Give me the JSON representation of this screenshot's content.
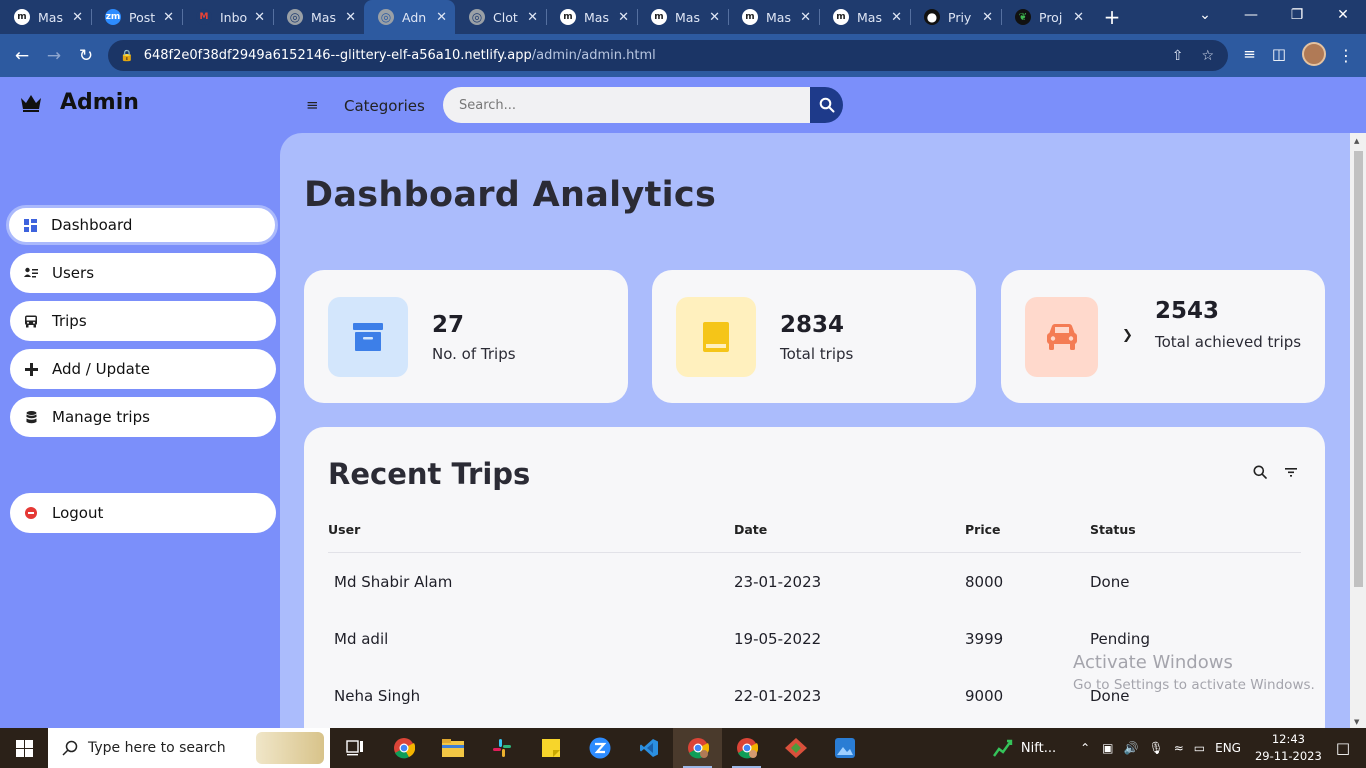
{
  "browser": {
    "tabs": [
      {
        "label": "Mas",
        "icon": "m",
        "icon_bg": "#ffffff",
        "icon_fg": "#222222"
      },
      {
        "label": "Post",
        "icon": "zm",
        "icon_bg": "#2d8cff",
        "icon_fg": "#ffffff"
      },
      {
        "label": "Inbo",
        "icon": "M",
        "icon_bg": "#1f3b6e",
        "icon_fg": "#ea4335"
      },
      {
        "label": "Mas",
        "icon": "globe",
        "icon_bg": "#9aa0a6",
        "icon_fg": "#1f3b6e"
      },
      {
        "label": "Adn",
        "icon": "globe",
        "icon_bg": "#9aa0a6",
        "icon_fg": "#2d5aa0"
      },
      {
        "label": "Clot",
        "icon": "globe",
        "icon_bg": "#9aa0a6",
        "icon_fg": "#1f3b6e"
      },
      {
        "label": "Mas",
        "icon": "m",
        "icon_bg": "#ffffff",
        "icon_fg": "#222222"
      },
      {
        "label": "Mas",
        "icon": "m",
        "icon_bg": "#ffffff",
        "icon_fg": "#222222"
      },
      {
        "label": "Mas",
        "icon": "m",
        "icon_bg": "#ffffff",
        "icon_fg": "#222222"
      },
      {
        "label": "Mas",
        "icon": "m",
        "icon_bg": "#ffffff",
        "icon_fg": "#222222"
      },
      {
        "label": "Priy",
        "icon": "gh",
        "icon_bg": "#111111",
        "icon_fg": "#ffffff"
      },
      {
        "label": "Proj",
        "icon": "leaf",
        "icon_bg": "#111111",
        "icon_fg": "#3fb950"
      }
    ],
    "active_tab_index": 4,
    "url_host": "648f2e0f38df2949a6152146--glittery-elf-a56a10.netlify.app",
    "url_path": "/admin/admin.html"
  },
  "app": {
    "brand": "Admin",
    "nav_toggle_label": "Categories",
    "search_placeholder": "Search...",
    "colors": {
      "accent": "#1e3a8a",
      "page_bg": "#7b8ffa",
      "content_bg": "#abbcfc"
    }
  },
  "sidebar": {
    "items": [
      {
        "label": "Dashboard",
        "icon": "grid-icon"
      },
      {
        "label": "Users",
        "icon": "users-list-icon"
      },
      {
        "label": "Trips",
        "icon": "bus-icon"
      },
      {
        "label": "Add / Update",
        "icon": "plus-icon"
      },
      {
        "label": "Manage trips",
        "icon": "database-icon"
      }
    ],
    "logout_label": "Logout"
  },
  "dashboard": {
    "title": "Dashboard Analytics",
    "cards": [
      {
        "value": "27",
        "label": "No. of Trips",
        "icon": "archive-icon",
        "icon_bg": "#d3e6fc",
        "icon_color": "#3d7fe8"
      },
      {
        "value": "2834",
        "label": "Total trips",
        "icon": "book-icon",
        "icon_bg": "#fff0be",
        "icon_color": "#f5c518"
      },
      {
        "value": "2543",
        "label": "Total achieved trips",
        "icon": "car-icon",
        "icon_bg": "#ffd9cc",
        "icon_color": "#f47c54"
      }
    ],
    "recent": {
      "title": "Recent Trips",
      "columns": [
        "User",
        "Date",
        "Price",
        "Status"
      ],
      "rows": [
        [
          "Md Shabir Alam",
          "23-01-2023",
          "8000",
          "Done"
        ],
        [
          "Md adil",
          "19-05-2022",
          "3999",
          "Pending"
        ],
        [
          "Neha Singh",
          "22-01-2023",
          "9000",
          "Done"
        ]
      ]
    }
  },
  "watermark": {
    "line1": "Activate Windows",
    "line2": "Go to Settings to activate Windows."
  },
  "taskbar": {
    "search_placeholder": "Type here to search",
    "tray_app_label": "Nift...",
    "language": "ENG",
    "time": "12:43",
    "date": "29-11-2023"
  }
}
